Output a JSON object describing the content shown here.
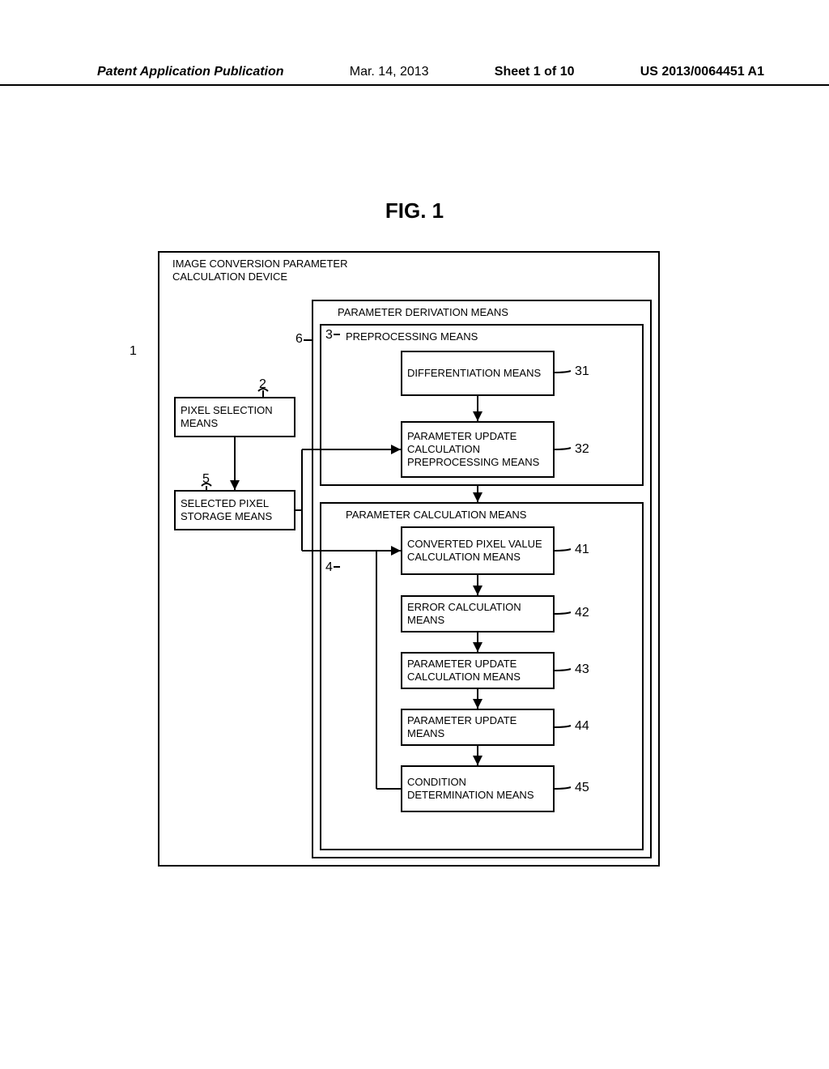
{
  "header": {
    "publication_title": "Patent Application Publication",
    "date": "Mar. 14, 2013",
    "sheet": "Sheet 1 of 10",
    "pub_number": "US 2013/0064451 A1"
  },
  "figure_label": "FIG. 1",
  "blocks": {
    "outer_title_line1": "IMAGE CONVERSION PARAMETER",
    "outer_title_line2": "CALCULATION DEVICE",
    "param_derivation_title": "PARAMETER DERIVATION MEANS",
    "preprocessing_title": "PREPROCESSING MEANS",
    "param_calculation_title": "PARAMETER CALCULATION MEANS",
    "pixel_selection": "PIXEL SELECTION MEANS",
    "selected_pixel_storage": "SELECTED PIXEL STORAGE MEANS",
    "differentiation": "DIFFERENTIATION MEANS",
    "param_update_preproc": "PARAMETER UPDATE CALCULATION PREPROCESSING MEANS",
    "converted_pixel_value": "CONVERTED PIXEL VALUE CALCULATION MEANS",
    "error_calc": "ERROR CALCULATION MEANS",
    "param_update_calc": "PARAMETER UPDATE CALCULATION MEANS",
    "param_update": "PARAMETER UPDATE MEANS",
    "condition_determination": "CONDITION DETERMINATION MEANS"
  },
  "refs": {
    "r1": "1",
    "r2": "2",
    "r3": "3",
    "r4": "4",
    "r5": "5",
    "r6": "6",
    "r31": "31",
    "r32": "32",
    "r41": "41",
    "r42": "42",
    "r43": "43",
    "r44": "44",
    "r45": "45"
  }
}
